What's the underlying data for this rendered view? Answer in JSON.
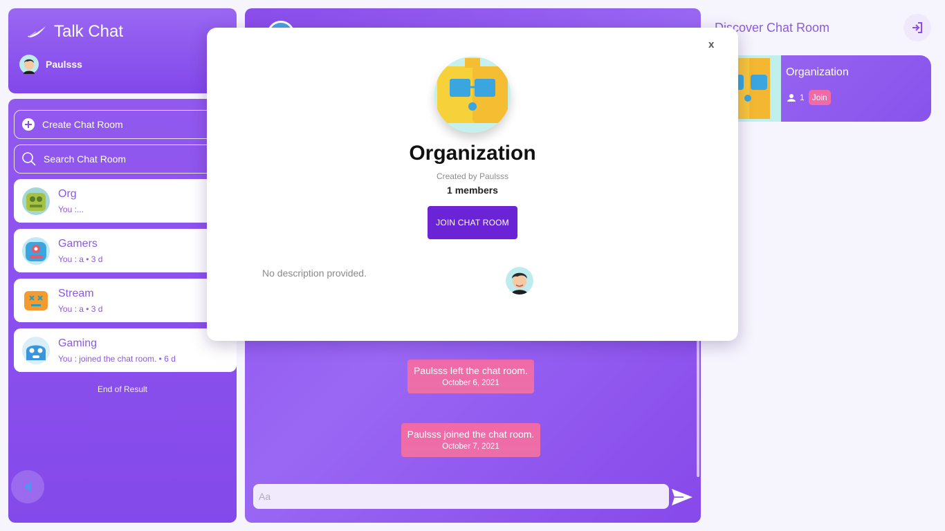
{
  "app": {
    "title": "Talk Chat",
    "user_name": "Paulsss"
  },
  "actions": {
    "create_label": "Create Chat Room",
    "search_label": "Search Chat Room"
  },
  "rooms": [
    {
      "name": "Org",
      "preview": "You :..."
    },
    {
      "name": "Gamers",
      "preview": "You : a • 3 d"
    },
    {
      "name": "Stream",
      "preview": "You : a • 3 d"
    },
    {
      "name": "Gaming",
      "preview": "You : joined the chat room. • 6 d"
    }
  ],
  "rooms_end_text": "End of Result",
  "chat": {
    "messages": [
      {
        "text": "Paulsss left the chat room.",
        "date": "October 6, 2021"
      },
      {
        "text": "Paulsss joined the chat room.",
        "date": "October 7, 2021"
      }
    ],
    "input_placeholder": "Aa"
  },
  "discover": {
    "title": "Discover Chat Room",
    "card": {
      "name": "Organization",
      "members": "1",
      "join_label": "Join"
    }
  },
  "modal": {
    "close_label": "x",
    "title": "Organization",
    "created_by": "Created by Paulsss",
    "members": "1 members",
    "join_label": "JOIN CHAT ROOM",
    "description": "No description provided."
  },
  "colors": {
    "primary": "#8a4dea",
    "accent_pink": "#f06aa8",
    "join_button": "#6a24d6"
  }
}
